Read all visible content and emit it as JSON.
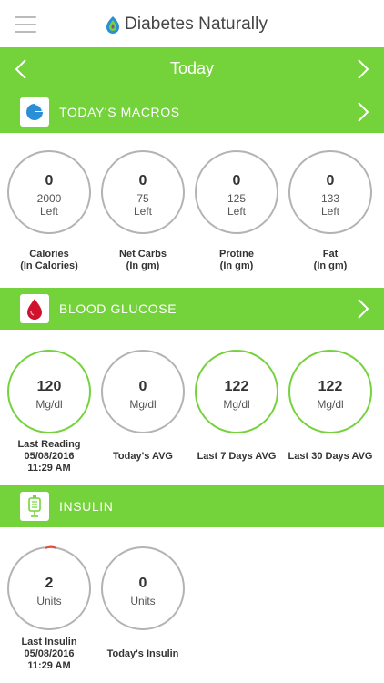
{
  "header": {
    "app_name": "Diabetes Naturally"
  },
  "day_nav": {
    "title": "Today"
  },
  "macros": {
    "title": "TODAY'S MACROS",
    "items": [
      {
        "value": "0",
        "remaining": "2000",
        "left_label": "Left",
        "label": "Calories",
        "unit": "(In Calories)"
      },
      {
        "value": "0",
        "remaining": "75",
        "left_label": "Left",
        "label": "Net Carbs",
        "unit": "(In gm)"
      },
      {
        "value": "0",
        "remaining": "125",
        "left_label": "Left",
        "label": "Protine",
        "unit": "(In gm)"
      },
      {
        "value": "0",
        "remaining": "133",
        "left_label": "Left",
        "label": "Fat",
        "unit": "(In gm)"
      }
    ]
  },
  "glucose": {
    "title": "BLOOD GLUCOSE",
    "items": [
      {
        "value": "120",
        "unit": "Mg/dl",
        "label": "Last Reading",
        "date": "05/08/2016",
        "time": "11:29 AM"
      },
      {
        "value": "0",
        "unit": "Mg/dl",
        "label": "Today's AVG"
      },
      {
        "value": "122",
        "unit": "Mg/dl",
        "label": "Last 7 Days AVG"
      },
      {
        "value": "122",
        "unit": "Mg/dl",
        "label": "Last 30 Days AVG"
      }
    ]
  },
  "insulin": {
    "title": "INSULIN",
    "items": [
      {
        "value": "2",
        "unit": "Units",
        "label": "Last Insulin",
        "date": "05/08/2016",
        "time": "11:29 AM"
      },
      {
        "value": "0",
        "unit": "Units",
        "label": "Today's Insulin"
      }
    ]
  },
  "colors": {
    "accent": "#74d23b",
    "ring_gray": "#b3b3b3",
    "blood_red": "#d0122c",
    "marker_red": "#e8473a"
  }
}
